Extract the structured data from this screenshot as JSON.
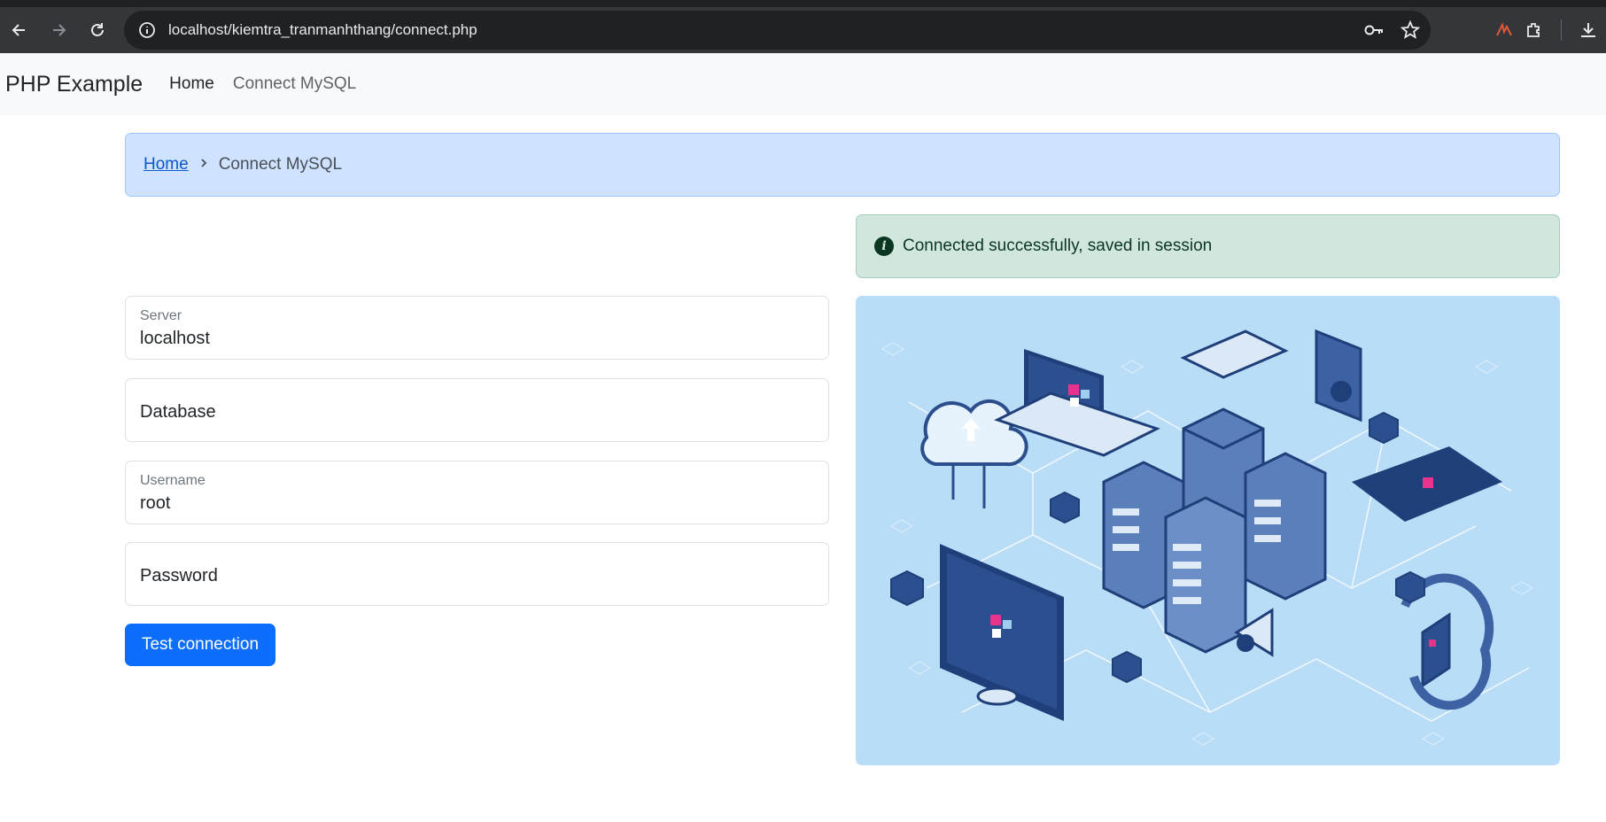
{
  "browser": {
    "url": "localhost/kiemtra_tranmanhthang/connect.php"
  },
  "navbar": {
    "brand": "PHP Example",
    "links": [
      {
        "label": "Home"
      },
      {
        "label": "Connect MySQL"
      }
    ]
  },
  "breadcrumb": {
    "home": "Home",
    "current": "Connect MySQL"
  },
  "alert": {
    "message": "Connected successfully, saved in session"
  },
  "form": {
    "server": {
      "label": "Server",
      "value": "localhost"
    },
    "database": {
      "label": "Database",
      "value": ""
    },
    "username": {
      "label": "Username",
      "value": "root"
    },
    "password": {
      "label": "Password",
      "value": ""
    },
    "submit_label": "Test connection"
  },
  "colors": {
    "primary": "#0d6efd",
    "breadcrumb_bg": "#cfe2ff",
    "alert_bg": "#d1e7dd",
    "illustration_bg": "#b9ddf7"
  }
}
